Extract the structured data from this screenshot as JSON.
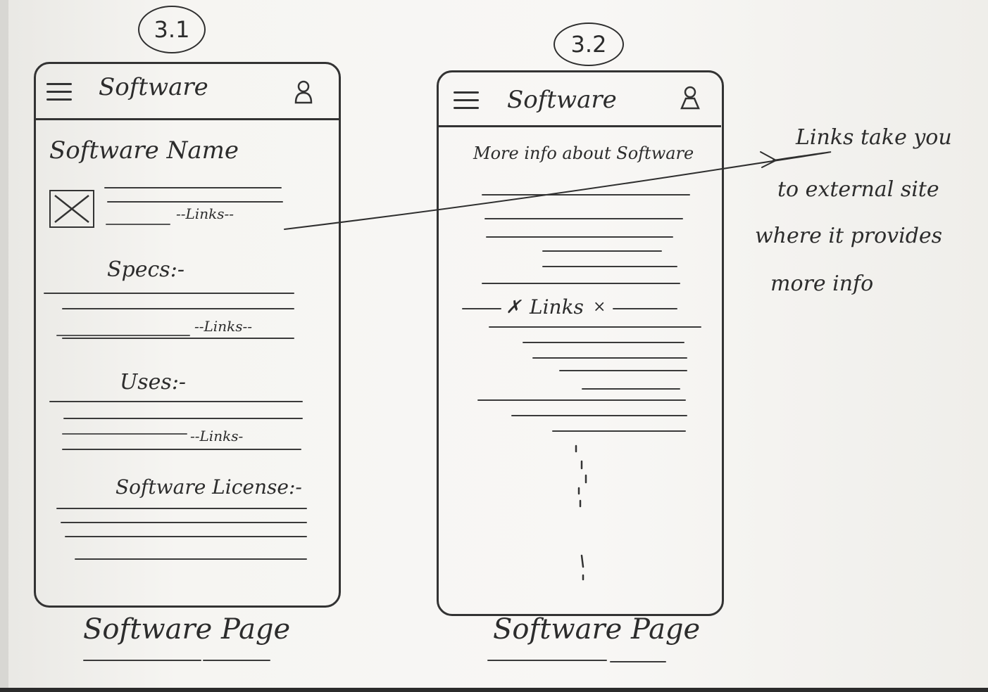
{
  "screen_3_1": {
    "number": "3.1",
    "appbar_title": "Software",
    "software_name": "Software Name",
    "links_1": "--Links--",
    "specs": "Specs:-",
    "links_2": "--Links--",
    "uses": "Uses:-",
    "links_3": "--Links-",
    "license": "Software License:-",
    "caption": "Software Page"
  },
  "screen_3_2": {
    "number": "3.2",
    "appbar_title": "Software",
    "more_info": "More info about Software",
    "links": "Links",
    "caption": "Software Page"
  },
  "annotation": {
    "line1": "Links take you",
    "line2": "to external site",
    "line3": "where it provides",
    "line4": "more info"
  }
}
